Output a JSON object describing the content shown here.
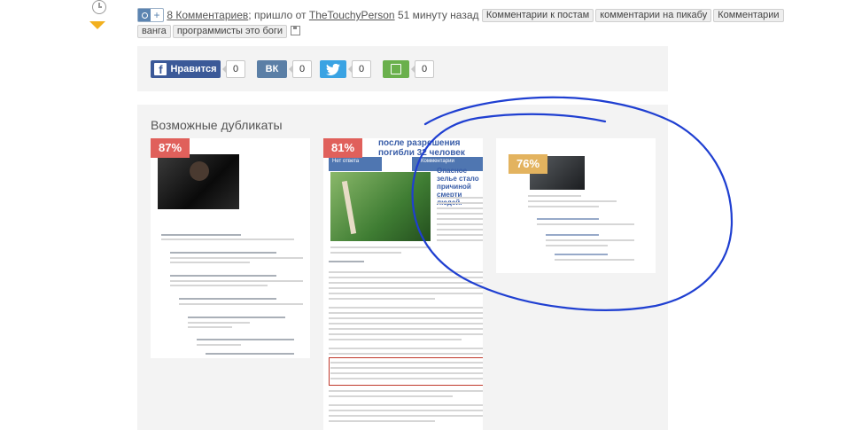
{
  "meta": {
    "comments_link": "8 Комментариев",
    "from_text": "; пришло от",
    "author": "TheTouchyPerson",
    "time_ago": "51 минуту назад",
    "tags": [
      "Комментарии к постам",
      "комментарии на пикабу",
      "Комментарии",
      "ванга",
      "программисты это боги"
    ]
  },
  "share": {
    "like_label": "Нравится",
    "facebook_count": "0",
    "vk_label": "ВК",
    "vk_count": "0",
    "twitter_count": "0",
    "save_count": "0"
  },
  "duplicates": {
    "title": "Возможные дубликаты",
    "items": [
      {
        "percent": "87%"
      },
      {
        "percent": "81%",
        "headline": "после разрешения погибли 32 человек",
        "side_title": "Опасное зелье стало причиной смерти людей.",
        "ribbon_left": "Нет ответа",
        "ribbon_right": "Комментарии"
      },
      {
        "percent": "76%"
      }
    ]
  },
  "colors": {
    "facebook": "#3b5998",
    "vk": "#5b7fa6",
    "twitter": "#3aa3e3",
    "save": "#6ab04c",
    "badge_high": "#e0605b",
    "badge_mid": "#e3b35f",
    "scribble": "#1f3fd1"
  },
  "icons": [
    "clock-icon",
    "rating-down-icon",
    "camera-icon",
    "plus-icon",
    "save-icon",
    "facebook-icon",
    "vk-icon",
    "twitter-icon"
  ]
}
